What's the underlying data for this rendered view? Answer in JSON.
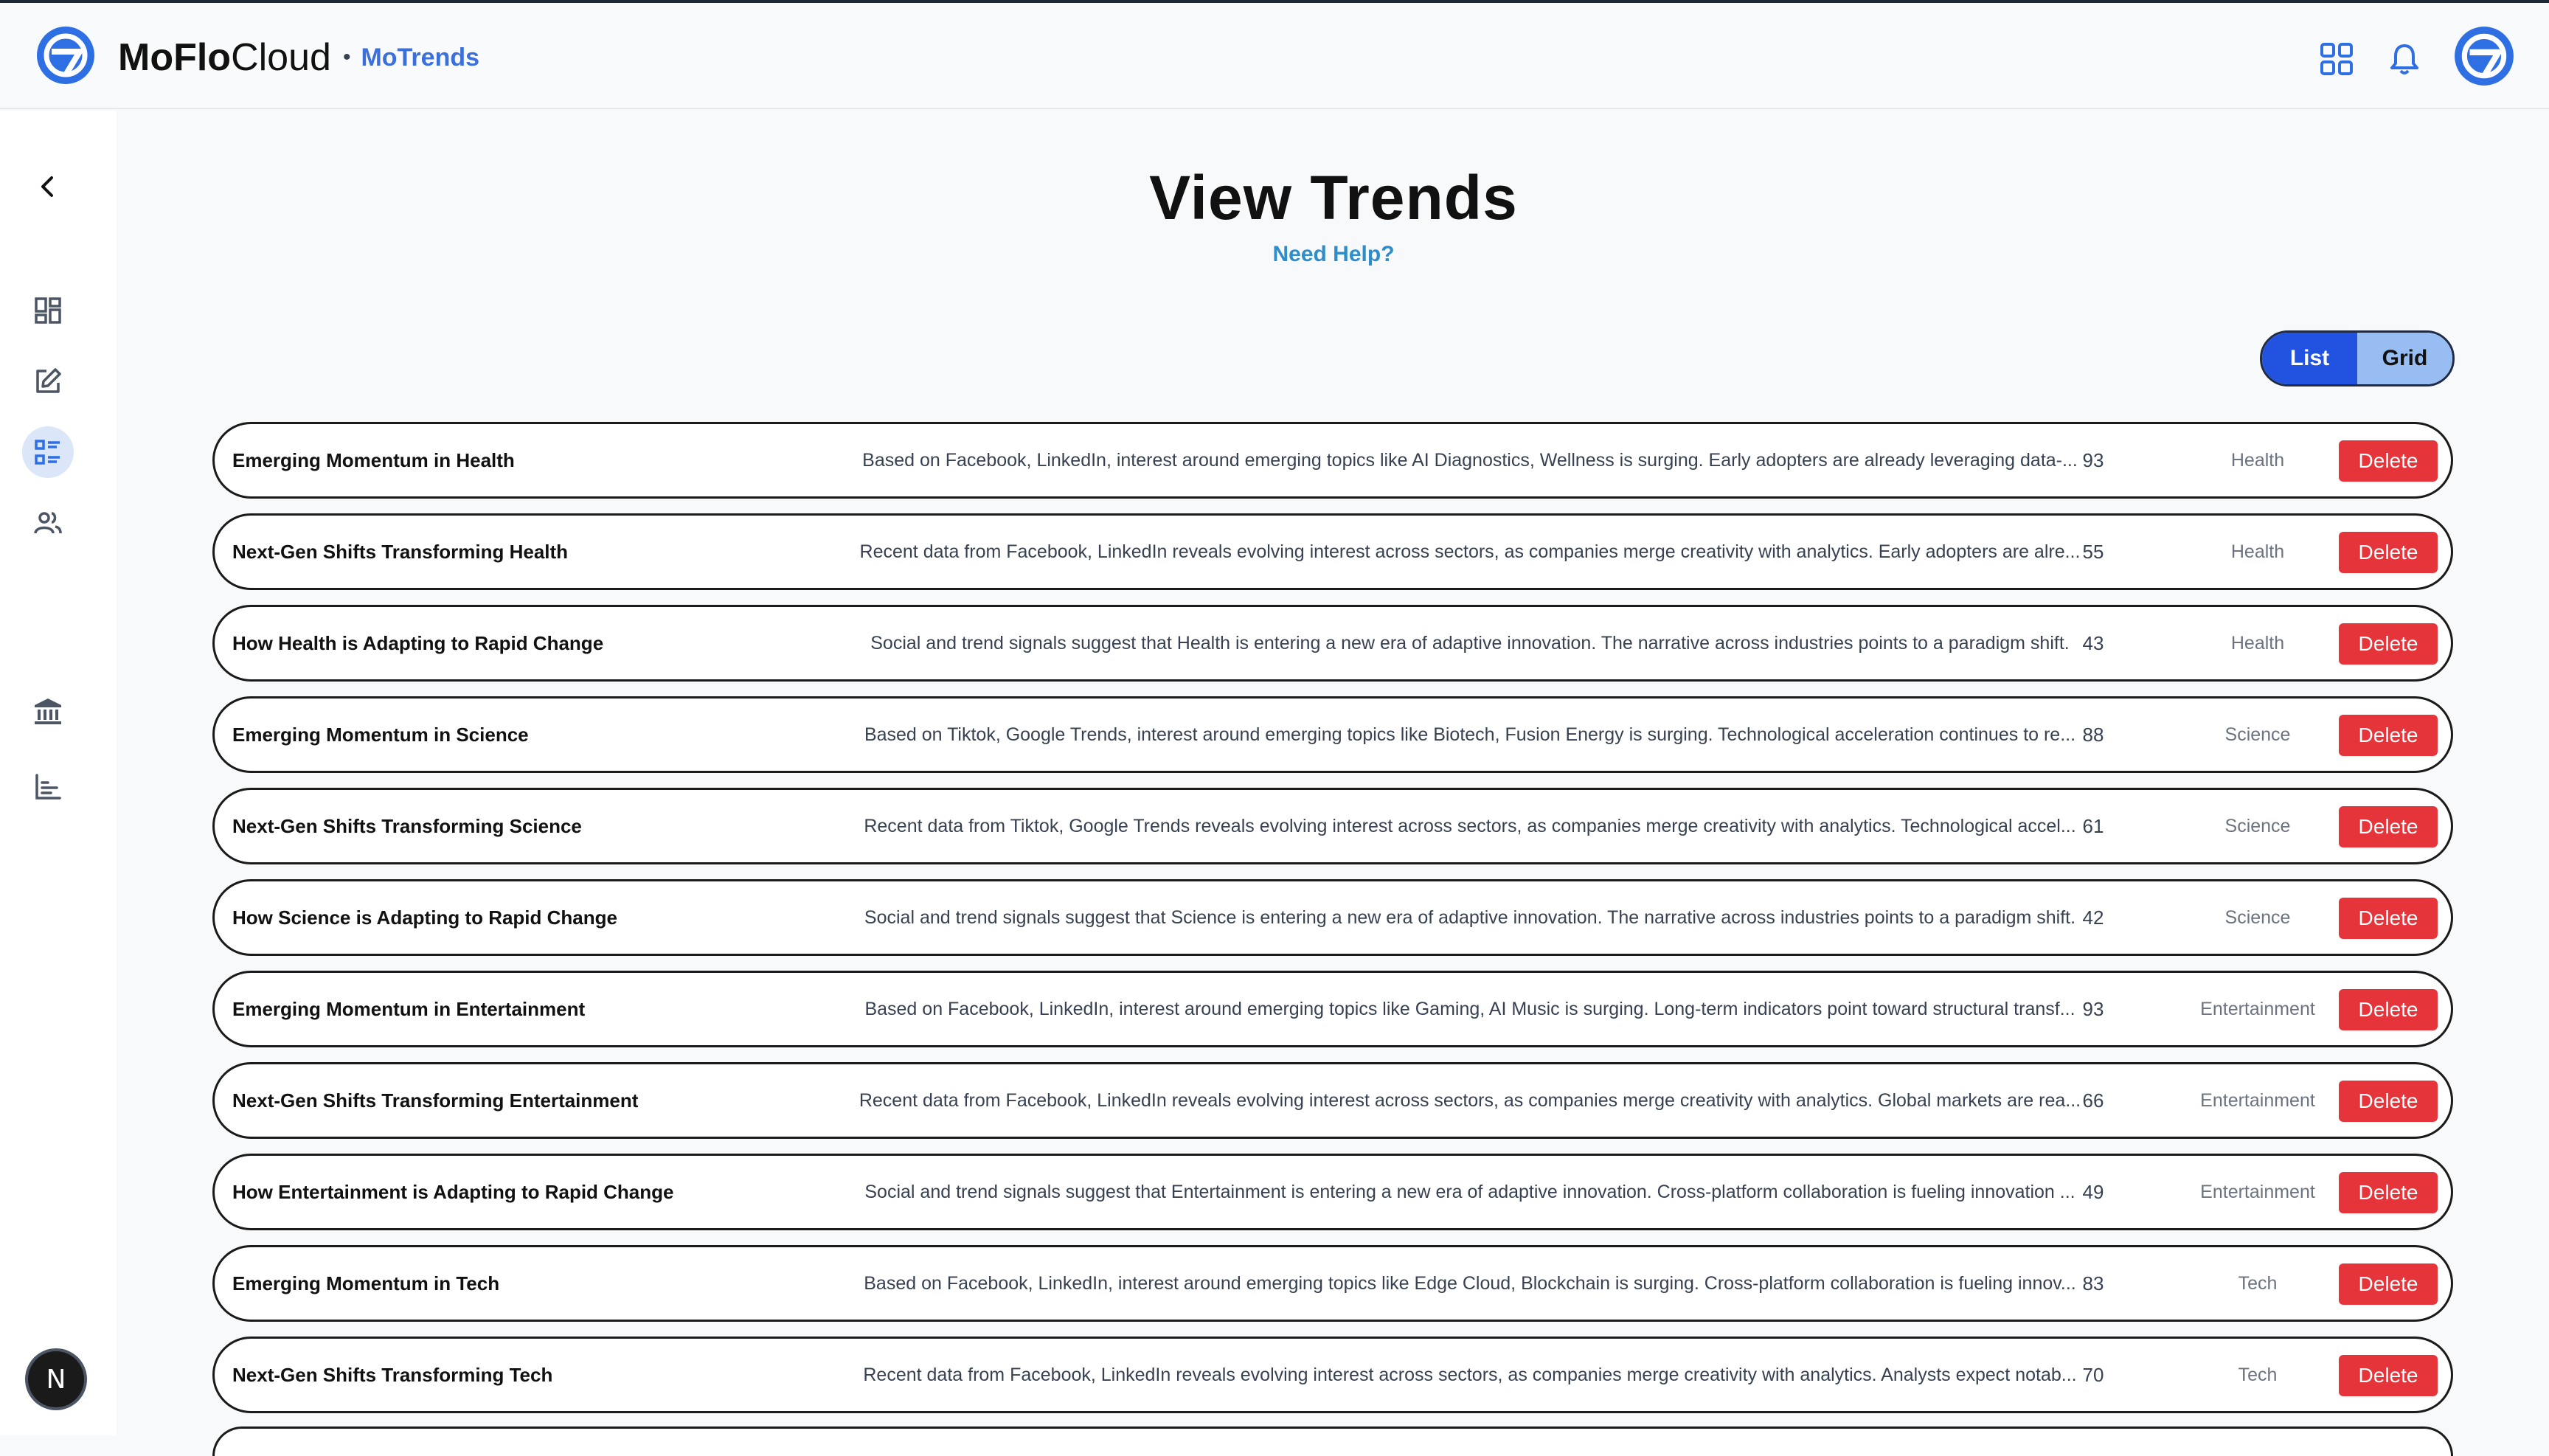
{
  "header": {
    "brand_bold": "MoFlo",
    "brand_light": "Cloud",
    "separator": "•",
    "product": "MoTrends",
    "icons": [
      "app-grid-icon",
      "bell-icon",
      "logo-icon"
    ]
  },
  "sidebar": {
    "items": [
      "chevron-left-icon",
      "dashboard-icon",
      "edit-icon",
      "list-icon",
      "users-icon",
      "bank-icon",
      "bar-chart-icon"
    ],
    "active": "list-icon",
    "badge": "N"
  },
  "page": {
    "title": "View Trends",
    "help": "Need Help?"
  },
  "view_toggle": {
    "list": "List",
    "grid": "Grid",
    "selected": "List"
  },
  "colors": {
    "accent": "#2153e0",
    "accent_light": "#98bdf3",
    "delete": "#e5343a",
    "brand_blue": "#3b6fd9",
    "help_link": "#2f8ec9"
  },
  "delete_label": "Delete",
  "trends": [
    {
      "title": "Emerging Momentum in Health",
      "description": "Based on Facebook, LinkedIn, interest around emerging topics like AI Diagnostics, Wellness is surging. Early adopters are already leveraging data-...",
      "score": "93",
      "category": "Health"
    },
    {
      "title": "Next-Gen Shifts Transforming Health",
      "description": "Recent data from Facebook, LinkedIn reveals evolving interest across sectors, as companies merge creativity with analytics. Early adopters are alre...",
      "score": "55",
      "category": "Health"
    },
    {
      "title": "How Health is Adapting to Rapid Change",
      "description": "Social and trend signals suggest that Health is entering a new era of adaptive innovation. The narrative across industries points to a paradigm shift.",
      "score": "43",
      "category": "Health"
    },
    {
      "title": "Emerging Momentum in Science",
      "description": "Based on Tiktok, Google Trends, interest around emerging topics like Biotech, Fusion Energy is surging. Technological acceleration continues to re...",
      "score": "88",
      "category": "Science"
    },
    {
      "title": "Next-Gen Shifts Transforming Science",
      "description": "Recent data from Tiktok, Google Trends reveals evolving interest across sectors, as companies merge creativity with analytics. Technological accel...",
      "score": "61",
      "category": "Science"
    },
    {
      "title": "How Science is Adapting to Rapid Change",
      "description": "Social and trend signals suggest that Science is entering a new era of adaptive innovation. The narrative across industries points to a paradigm shift.",
      "score": "42",
      "category": "Science"
    },
    {
      "title": "Emerging Momentum in Entertainment",
      "description": "Based on Facebook, LinkedIn, interest around emerging topics like Gaming, AI Music is surging. Long-term indicators point toward structural transf...",
      "score": "93",
      "category": "Entertainment"
    },
    {
      "title": "Next-Gen Shifts Transforming Entertainment",
      "description": "Recent data from Facebook, LinkedIn reveals evolving interest across sectors, as companies merge creativity with analytics. Global markets are rea...",
      "score": "66",
      "category": "Entertainment"
    },
    {
      "title": "How Entertainment is Adapting to Rapid Change",
      "description": "Social and trend signals suggest that Entertainment is entering a new era of adaptive innovation. Cross-platform collaboration is fueling innovation ...",
      "score": "49",
      "category": "Entertainment"
    },
    {
      "title": "Emerging Momentum in Tech",
      "description": "Based on Facebook, LinkedIn, interest around emerging topics like Edge Cloud, Blockchain is surging. Cross-platform collaboration is fueling innov...",
      "score": "83",
      "category": "Tech"
    },
    {
      "title": "Next-Gen Shifts Transforming Tech",
      "description": "Recent data from Facebook, LinkedIn reveals evolving interest across sectors, as companies merge creativity with analytics. Analysts expect notab...",
      "score": "70",
      "category": "Tech"
    }
  ]
}
